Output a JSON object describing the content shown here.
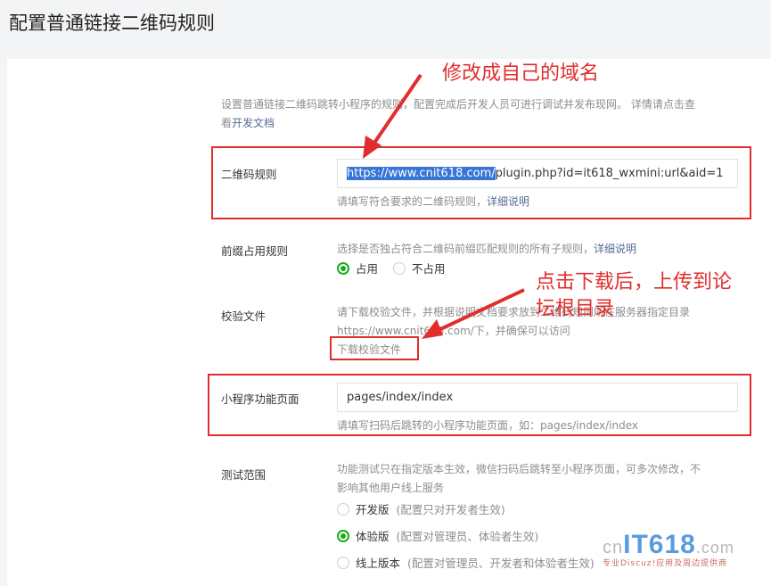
{
  "page": {
    "title": "配置普通链接二维码规则"
  },
  "intro": {
    "text": "设置普通链接二维码跳转小程序的规则，配置完成后开发人员可进行调试并发布现网。 详情请点击查",
    "text2": "看",
    "doc_link": "开发文档"
  },
  "qr_rule": {
    "label": "二维码规则",
    "value_selected": "https://www.cnit618.com/",
    "value_rest": "plugin.php?id=it618_wxmini:url&aid=1",
    "hint": "请填写符合要求的二维码规则，",
    "hint_link": "详细说明"
  },
  "prefix_rule": {
    "label": "前缀占用规则",
    "desc": "选择是否独占符合二维码前缀匹配规则的所有子规则，",
    "desc_link": "详细说明",
    "options": [
      {
        "label": "占用",
        "checked": true
      },
      {
        "label": "不占用",
        "checked": false
      }
    ]
  },
  "verify_file": {
    "label": "校验文件",
    "desc_line1": "请下载校验文件，并根据说明文档要求放到二维码规则所在服务器指定目录",
    "desc_line2": "https://www.cnit618.com/下，并确保可以访问",
    "download_link": "下载校验文件"
  },
  "mp_page": {
    "label": "小程序功能页面",
    "value": "pages/index/index",
    "hint": "请填写扫码后跳转的小程序功能页面，如：pages/index/index"
  },
  "test_scope": {
    "label": "测试范围",
    "desc_line1": "功能测试只在指定版本生效，微信扫码后跳转至小程序页面，可多次修改，不",
    "desc_line2": "影响其他用户线上服务",
    "options": [
      {
        "label": "开发版",
        "note": "(配置只对开发者生效)",
        "checked": false
      },
      {
        "label": "体验版",
        "note": "(配置对管理员、体验者生效)",
        "checked": true
      },
      {
        "label": "线上版本",
        "note": "(配置对管理员、开发者和体验者生效)",
        "checked": false
      }
    ]
  },
  "annotations": {
    "note1": "修改成自己的域名",
    "note2_line1": "点击下载后，上传到论",
    "note2_line2": "坛根目录"
  },
  "watermark": {
    "cn": "cn",
    "it": "IT618",
    "com": ".com",
    "sub": "专业Discuz!应用及周边提供商"
  },
  "colors": {
    "annotation_red": "#e12d2d",
    "link_blue": "#576b95",
    "radio_green": "#1aad19",
    "selection_blue": "#3875d6"
  }
}
